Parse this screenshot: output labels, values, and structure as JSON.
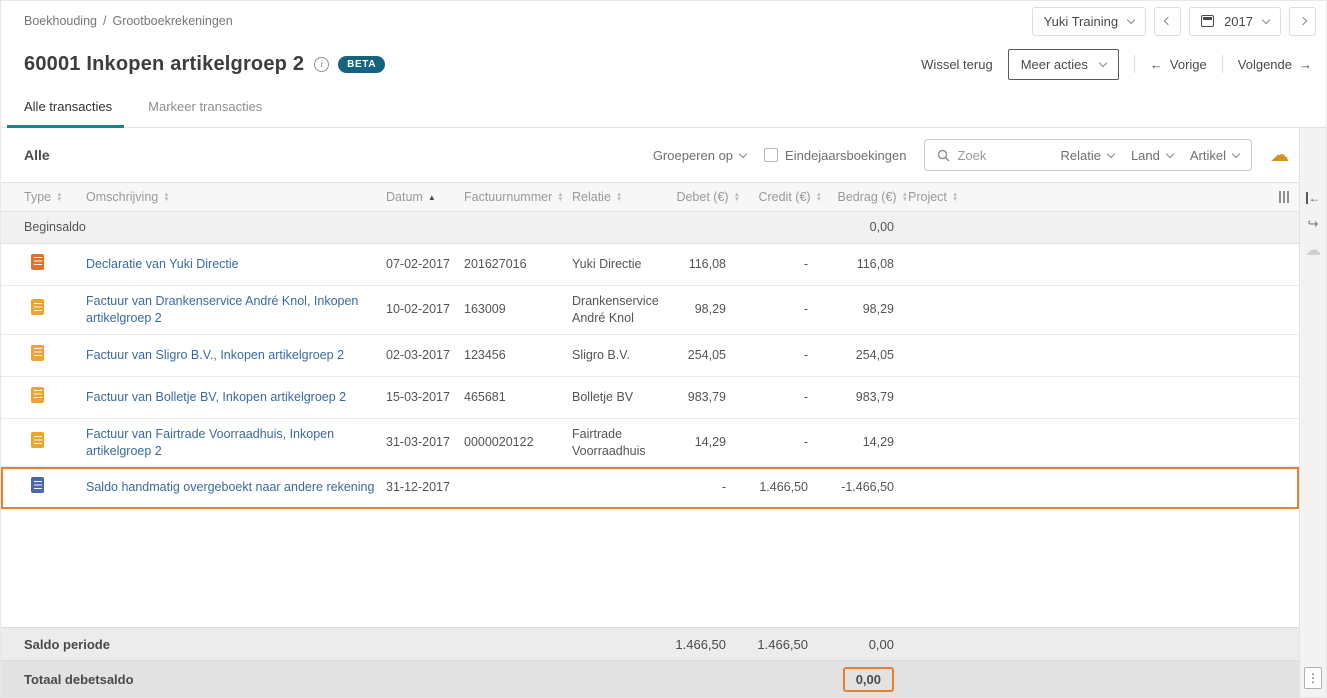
{
  "colors": {
    "accent_teal": "#19808c",
    "highlight_orange": "#e8802f",
    "link_blue": "#3a6b9f",
    "beta_badge": "#16637f"
  },
  "topbar": {
    "breadcrumb": [
      "Boekhouding",
      "Grootboekrekeningen"
    ],
    "breadcrumb_separator": "/",
    "administration": "Yuki Training",
    "year": "2017"
  },
  "titlebar": {
    "title": "60001 Inkopen artikelgroep 2",
    "beta": "BETA",
    "wissel_terug": "Wissel terug",
    "meer_acties": "Meer acties",
    "vorige": "Vorige",
    "volgende": "Volgende"
  },
  "tabs": [
    {
      "label": "Alle transacties",
      "active": true
    },
    {
      "label": "Markeer transacties",
      "active": false
    }
  ],
  "filter": {
    "title": "Alle",
    "groeperen_op": "Groeperen op",
    "eindejaarsboekingen": "Eindejaarsboekingen",
    "search_placeholder": "Zoek",
    "dropdowns": [
      "Relatie",
      "Land",
      "Artikel"
    ]
  },
  "table": {
    "columns": [
      {
        "label": "Type",
        "align": "left",
        "sort": "both"
      },
      {
        "label": "Omschrijving",
        "align": "left",
        "sort": "both"
      },
      {
        "label": "Datum",
        "align": "left",
        "sort": "asc"
      },
      {
        "label": "Factuurnummer",
        "align": "left",
        "sort": "both"
      },
      {
        "label": "Relatie",
        "align": "left",
        "sort": "both"
      },
      {
        "label": "Debet (€)",
        "align": "right",
        "sort": "both"
      },
      {
        "label": "Credit (€)",
        "align": "right",
        "sort": "both"
      },
      {
        "label": "Bedrag (€)",
        "align": "right",
        "sort": "both"
      },
      {
        "label": "Project",
        "align": "left",
        "sort": "both"
      }
    ],
    "beginsaldo": {
      "label": "Beginsaldo",
      "bedrag": "0,00"
    },
    "rows": [
      {
        "icon": "declaration-document-icon",
        "icon_color": "#e4702e",
        "omschrijving": "Declaratie van Yuki Directie",
        "datum": "07-02-2017",
        "factuurnummer": "201627016",
        "relatie": "Yuki Directie",
        "debet": "116,08",
        "credit": "-",
        "bedrag": "116,08",
        "project": "",
        "highlight": false
      },
      {
        "icon": "invoice-document-icon",
        "icon_color": "#efa42c",
        "omschrijving": "Factuur van Drankenservice André Knol, Inkopen artikelgroep 2",
        "datum": "10-02-2017",
        "factuurnummer": "163009",
        "relatie": "Drankenservice André Knol",
        "debet": "98,29",
        "credit": "-",
        "bedrag": "98,29",
        "project": "",
        "highlight": false
      },
      {
        "icon": "invoice-document-icon",
        "icon_color": "#efa42c",
        "omschrijving": "Factuur van Sligro B.V., Inkopen artikelgroep 2",
        "datum": "02-03-2017",
        "factuurnummer": "123456",
        "relatie": "Sligro B.V.",
        "debet": "254,05",
        "credit": "-",
        "bedrag": "254,05",
        "project": "",
        "highlight": false
      },
      {
        "icon": "invoice-document-icon",
        "icon_color": "#efa42c",
        "omschrijving": "Factuur van Bolletje BV, Inkopen artikelgroep 2",
        "datum": "15-03-2017",
        "factuurnummer": "465681",
        "relatie": "Bolletje BV",
        "debet": "983,79",
        "credit": "-",
        "bedrag": "983,79",
        "project": "",
        "highlight": false
      },
      {
        "icon": "invoice-document-icon",
        "icon_color": "#efa42c",
        "omschrijving": "Factuur van Fairtrade Voorraadhuis, Inkopen artikelgroep 2",
        "datum": "31-03-2017",
        "factuurnummer": "0000020122",
        "relatie": "Fairtrade Voorraadhuis",
        "debet": "14,29",
        "credit": "-",
        "bedrag": "14,29",
        "project": "",
        "highlight": false
      },
      {
        "icon": "journal-document-icon",
        "icon_color": "#4a67ad",
        "omschrijving": "Saldo handmatig overgeboekt naar andere rekening",
        "datum": "31-12-2017",
        "factuurnummer": "",
        "relatie": "",
        "debet": "-",
        "credit": "1.466,50",
        "bedrag": "-1.466,50",
        "project": "",
        "highlight": true
      }
    ],
    "footers": [
      {
        "label": "Saldo periode",
        "debet": "1.466,50",
        "credit": "1.466,50",
        "bedrag": "0,00"
      },
      {
        "label": "Totaal debetsaldo",
        "bedrag": "0,00"
      }
    ]
  }
}
